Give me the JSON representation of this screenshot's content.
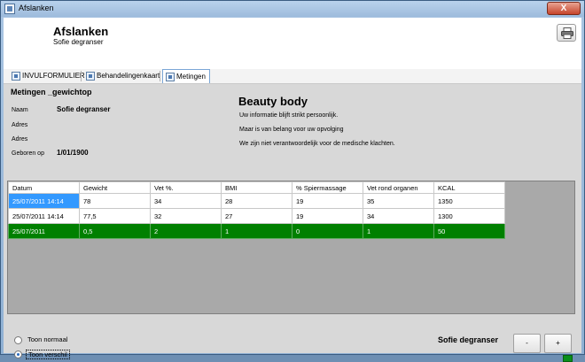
{
  "window": {
    "title": "Afslanken",
    "close_label": "X"
  },
  "header": {
    "title": "Afslanken",
    "subtitle": "Sofie degranser"
  },
  "tabs": [
    {
      "label": "INVULFORMULIER"
    },
    {
      "label": "Behandelingenkaart"
    },
    {
      "label": "Metingen"
    }
  ],
  "details": {
    "title": "Metingen _gewichtop",
    "name_label": "Naam",
    "name_value": "Sofie degranser",
    "address_label": "Adres",
    "address2_label": "Adres",
    "birth_label": "Geboren op",
    "birth_value": "1/01/1900"
  },
  "brand": {
    "title": "Beauty body",
    "lines": [
      "Uw informatie blijft strikt persoonlijk.",
      "Maar is van belang voor uw opvolging",
      "We zijn niet verantwoordelijk voor de medische klachten."
    ]
  },
  "table": {
    "columns": [
      "Datum",
      "Gewicht",
      "Vet %.",
      "BMI",
      "% Spiermassage",
      "Vet rond organen",
      "KCAL"
    ],
    "rows": [
      [
        "25/07/2011 14:14",
        "78",
        "34",
        "28",
        "19",
        "35",
        "1350"
      ],
      [
        "25/07/2011 14:14",
        "77,5",
        "32",
        "27",
        "19",
        "34",
        "1300"
      ],
      [
        "25/07/2011",
        "0,5",
        "2",
        "1",
        "0",
        "1",
        "50"
      ]
    ]
  },
  "view": {
    "normal_label": "Toon normaal",
    "diff_label": "Toon verschil"
  },
  "footer": {
    "name": "Sofie degranser",
    "minus_label": "-",
    "plus_label": "+"
  },
  "colors": {
    "selection": "#3399ff",
    "difference_row": "#008000",
    "status_light": "#0a8f1a"
  }
}
